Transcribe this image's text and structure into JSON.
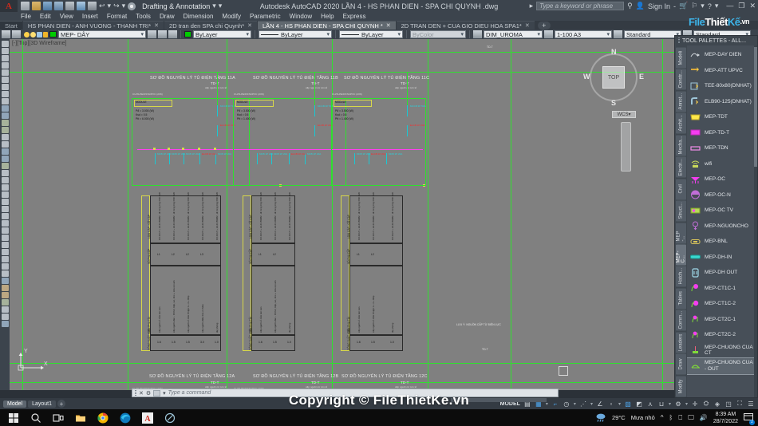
{
  "titlebar": {
    "app_title": "Autodesk AutoCAD 2020    LẦN 4 - HS PHAN DIEN - SPA CHI QUYNH .dwg",
    "workspace": "Drafting & Annotation",
    "search_placeholder": "Type a keyword or phrase",
    "sign_in": "Sign In",
    "quick_access": [
      "new-document",
      "open",
      "save",
      "save-as",
      "plot",
      "share",
      "print",
      "undo",
      "redo"
    ],
    "window_controls": [
      "minimize",
      "restore",
      "close"
    ]
  },
  "menubar": {
    "items": [
      "File",
      "Edit",
      "View",
      "Insert",
      "Format",
      "Tools",
      "Draw",
      "Dimension",
      "Modify",
      "Parametric",
      "Window",
      "Help",
      "Express"
    ]
  },
  "tabs": {
    "start_label": "Start",
    "items": [
      {
        "label": "HS PHAN DIEN - ANH VUONG - THANH TRI*",
        "active": false
      },
      {
        "label": "2D tran den SPA chi Quynh*",
        "active": false
      },
      {
        "label": "LẦN 4 - HS PHAN DIEN - SPA CHI QUYNH *",
        "active": true
      },
      {
        "label": "2D TRAN DEN + CUA GIO DIEU HOA SPA1*",
        "active": false
      }
    ],
    "new_tab": "+"
  },
  "properties_toolbar": {
    "layer": "MEP- DÂY",
    "color": "ByLayer",
    "linetype": "ByLayer",
    "lineweight": "ByLayer",
    "transparency": "ByColor",
    "dim_style": "DIM_UROMA",
    "scale": "1-100 A3",
    "text_style": "Standard",
    "table_style": "Standard",
    "layer_color_hex": "#00cc00"
  },
  "viewport": {
    "label": "[-][Top][3D Wireframe]",
    "ucs_x": "X",
    "ucs_y": "Y",
    "viewcube": {
      "top": "TOP",
      "n": "N",
      "s": "S",
      "e": "E",
      "w": "W"
    },
    "wcs": "WCS"
  },
  "drawing": {
    "panel_titles_top": [
      "SƠ ĐỒ NGUYÊN LÝ TỦ ĐIỆN TẦNG 11A",
      "SƠ ĐỒ NGUYÊN LÝ TỦ ĐIỆN TẦNG 11B",
      "SƠ ĐỒ NGUYÊN LÝ TỦ ĐIỆN TẦNG 11C"
    ],
    "panel_titles_bottom": [
      "SƠ ĐỒ NGUYÊN LÝ TỦ ĐIỆN TẦNG 12A",
      "SƠ ĐỒ NGUYÊN LÝ TỦ ĐIỆN TẦNG 12B",
      "SƠ ĐỒ NGUYÊN LÝ TỦ ĐIỆN TẦNG 12C"
    ],
    "sub_label": "TD-T",
    "sub_label2": "cấp nguồn từ tơn tổ",
    "cable_label": "CU/XLPE/DSTA/PVC (2X6)",
    "module_label": "MODULE",
    "module_lines": [
      "Pđ = 3.000 (W)",
      "Ksd = 0.5",
      "Ptt = 6.000 (W)"
    ],
    "module_lines_b": [
      "Pđ = 3.500 (W)",
      "Ksd = 0.5",
      "Ptt = 1.400 (W)"
    ],
    "module_lines_c": [
      "Pđ = 3.500 (W)",
      "Ksd = 0.5",
      "Ptt = 1.400 (W)"
    ],
    "breaker_labels": [
      "MCCB 3P 50A",
      "MCB 1P 20A",
      "ELCB 1P 20A"
    ],
    "table_headers": [
      "CÔNG SUẤT (KW)",
      "TÊN PHỤ TẢI",
      "SỐ PHA CẤP",
      "LOẠI CÁP - CỠ CÁP"
    ],
    "table_rows": [
      {
        "cs": "1.6",
        "ten": "cấp nguồn ổ cắm âm sàn",
        "pha": "L1",
        "cap": "CV 2X1.5 + E1X1.5MM2 - đi trong ống PVC D20"
      },
      {
        "cs": "1.5",
        "ten": "cấp nguồn đèn - P.Chờ, bếp, wc, kho + nhà vệ sinh",
        "pha": "L2",
        "cap": "CV 2X1.0 + E1X1.0MM2 - đi trong ống PVC D20"
      },
      {
        "cs": "1.5",
        "ten": "cấp nguồn ổ cắm P.Ngủ 1 + 2 + Bếp",
        "pha": "L2",
        "cap": "CV 2X1.5 + E1X1.5MM2 - đi trong ống PVC D20"
      },
      {
        "cs": "3.0",
        "ten": "cấp nguồn điều hòa 2 chiều",
        "pha": "L3",
        "cap": "CV 2X2.5 + E1X2.5MM2 - đi trong ống PVC D20"
      },
      {
        "cs": "1.0",
        "ten": "dự phòng",
        "pha": "",
        "cap": "CV 2X1.5 + E1X1.5MM2 - đi trong ống PVC D20"
      }
    ],
    "note_text": "LƯU Ý: NGUỒN CẤP TỪ ĐIỆN LỰC",
    "note_small": "TD-T"
  },
  "tool_palette": {
    "title": "TOOL PALETTES - ALL...",
    "tabs": [
      "Modeli",
      "Constr...",
      "Annot...",
      "Archit...",
      "Mecha...",
      "Electri...",
      "Civil",
      "Struct...",
      "MEP -...",
      "MEP-C...",
      "Hatch...",
      "Tables",
      "Comm...",
      "Leaders",
      "Draw",
      "Modify"
    ],
    "selected_tab": "MEP-C...",
    "items": [
      {
        "label": "MEP-DAY DIEN",
        "color": "#cfd5da",
        "selected": false
      },
      {
        "label": "MEP-ATT UPVC",
        "color": "#d9a83a",
        "selected": false
      },
      {
        "label": "TEE-80x80(DNHAT)",
        "color": "#9ec5d8",
        "selected": false
      },
      {
        "label": "ELB90-125(DNHAT)",
        "color": "#9ec5d8",
        "selected": false
      },
      {
        "label": "MEP-TDT",
        "color": "#ffe84a",
        "selected": false
      },
      {
        "label": "MEP-TD-T",
        "color": "#f43df0",
        "selected": false
      },
      {
        "label": "MEP-TDN",
        "color": "#f08ce8",
        "selected": false
      },
      {
        "label": "wifi",
        "color": "#c9d95a",
        "selected": false
      },
      {
        "label": "MEP-OC",
        "color": "#f43df0",
        "selected": false
      },
      {
        "label": "MEP-OC-N",
        "color": "#c26ed8",
        "selected": false
      },
      {
        "label": "MEP-OC TV",
        "color": "#b7d95a",
        "selected": false
      },
      {
        "label": "MEP-NGUONCHO",
        "color": "#c26ed8",
        "selected": false
      },
      {
        "label": "MEP-BNL",
        "color": "#d9c45a",
        "selected": false
      },
      {
        "label": "MEP-DH-IN",
        "color": "#3ad9d0",
        "selected": false
      },
      {
        "label": "MEP-DH OUT",
        "color": "#9ed8e8",
        "selected": false
      },
      {
        "label": "MEP-CT1C-1",
        "color": "#f43df0",
        "selected": false
      },
      {
        "label": "MEP-CT1C-2",
        "color": "#f43df0",
        "selected": false
      },
      {
        "label": "MEP-CT2C-1",
        "color": "#f43df0",
        "selected": false
      },
      {
        "label": "MEP-CT2C-2",
        "color": "#f43df0",
        "selected": false
      },
      {
        "label": "MEP-CHUONG CUA CT",
        "color": "#7fd93a",
        "selected": false
      },
      {
        "label": "MEP-CHUONG CUA - OUT",
        "color": "#7fd93a",
        "selected": true
      }
    ]
  },
  "command_line": {
    "placeholder": "Type a command"
  },
  "statusbar": {
    "model_tab": "Model",
    "layout_tab": "Layout1",
    "add_layout": "+",
    "space": "MODEL",
    "toggles": [
      "grid-display",
      "snap-mode",
      "ortho-mode",
      "polar-tracking",
      "object-snap",
      "object-snap-tracking",
      "otrack",
      "lineweight",
      "annotation-visibility",
      "annotation-scale",
      "workspace-switching",
      "hardware-acceleration",
      "isolate-objects",
      "customization"
    ]
  },
  "taskbar": {
    "apps": [
      "start",
      "search",
      "task-view",
      "file-explorer",
      "chrome",
      "edge",
      "autocad",
      "sketch-app"
    ],
    "weather_temp": "29°C",
    "weather_desc": "Mưa nhỏ",
    "time": "8:39 AM",
    "date": "28/7/2022",
    "tray": [
      "caret-up",
      "bluetooth",
      "battery",
      "network",
      "volume"
    ],
    "notification_count": "2"
  },
  "watermark": {
    "logo_file": "File",
    "logo_thiet": "Thiết",
    "logo_ke": "Kế",
    "logo_vn": ".vn",
    "center_text": "Copyright © FileThietKe.vn"
  }
}
